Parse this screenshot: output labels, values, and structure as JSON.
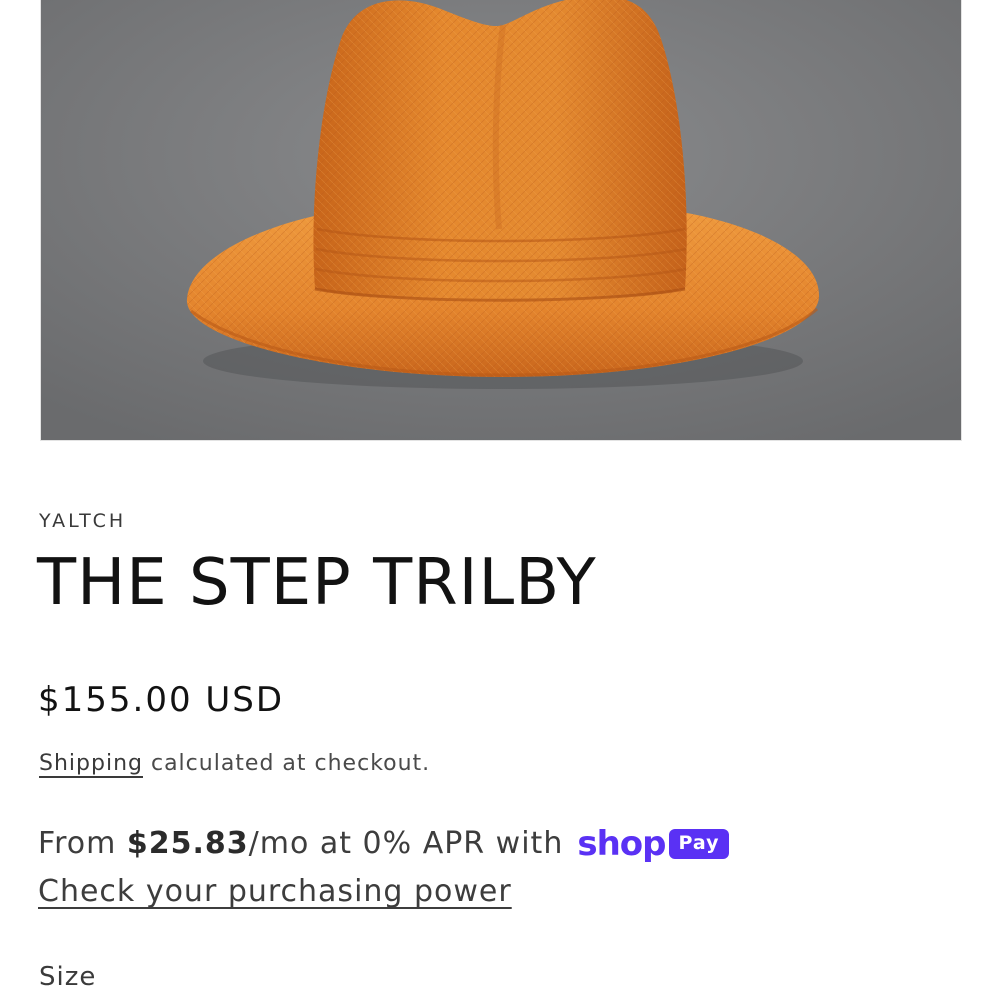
{
  "product": {
    "image_alt": "Orange straw trilby hat",
    "vendor": "YALTCH",
    "title": "THE STEP TRILBY",
    "price": "$155.00 USD"
  },
  "shipping": {
    "link_label": "Shipping",
    "suffix": " calculated at checkout."
  },
  "installments": {
    "prefix": "From ",
    "amount": "$25.83",
    "suffix": "/mo at 0% APR with",
    "shop_word": "shop",
    "pay_word": "Pay",
    "link_label": "Check your purchasing power"
  },
  "options": {
    "size_label": "Size"
  },
  "colors": {
    "shop_pay_purple": "#5a31f4",
    "background_gray": "#7a7b7d",
    "hat_orange": "#e07f28"
  }
}
